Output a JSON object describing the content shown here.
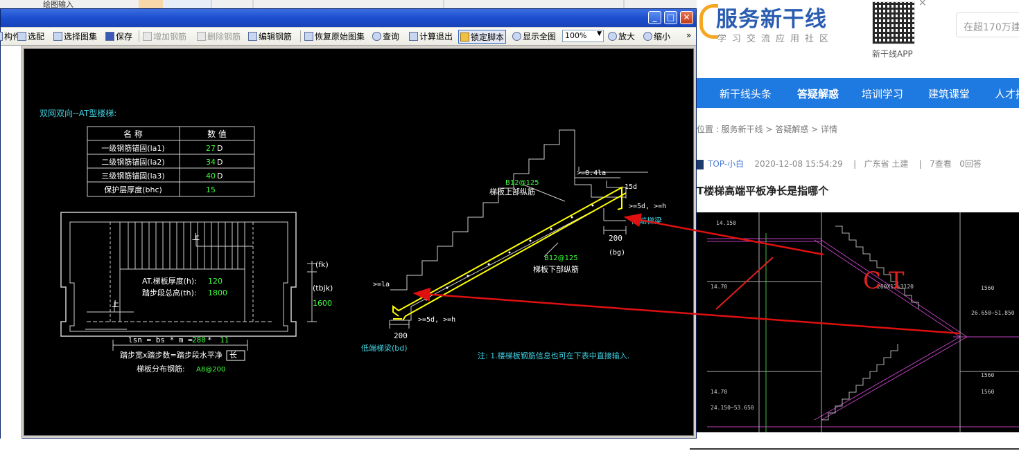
{
  "app": {
    "top_strip_label": "绘图输入",
    "window_buttons": {
      "minimize": "_",
      "maximize": "□",
      "close": "✕"
    },
    "toolbar": {
      "items": [
        {
          "label": "构件",
          "icon": "component-icon"
        },
        {
          "label": "选配",
          "icon": "select-config-icon"
        },
        {
          "label": "选择图集",
          "icon": "atlas-icon"
        },
        {
          "label": "保存",
          "icon": "save-icon"
        },
        {
          "label": "增加钢筋",
          "icon": "add-rebar-icon",
          "disabled": true
        },
        {
          "label": "删除钢筋",
          "icon": "delete-rebar-icon",
          "disabled": true
        },
        {
          "label": "编辑钢筋",
          "icon": "edit-rebar-icon"
        },
        {
          "label": "恢复原始图集",
          "icon": "restore-atlas-icon"
        },
        {
          "label": "查询",
          "icon": "binoculars-icon"
        },
        {
          "label": "计算退出",
          "icon": "calc-exit-icon"
        },
        {
          "label": "锁定脚本",
          "icon": "lock-icon",
          "pressed": true
        },
        {
          "label": "显示全图",
          "icon": "show-all-icon"
        },
        {
          "label": "放大",
          "icon": "zoom-in-icon"
        },
        {
          "label": "缩小",
          "icon": "zoom-out-icon"
        }
      ],
      "zoom_value": "100%",
      "overflow": "»"
    },
    "drawing": {
      "title": "双网双向--AT型楼梯:",
      "table_headers": [
        "名  称",
        "数  值"
      ],
      "table_rows": [
        {
          "name": "一级钢筋锚固(la1)",
          "value": "27",
          "unit": "D"
        },
        {
          "name": "二级钢筋锚固(la2)",
          "value": "34",
          "unit": "D"
        },
        {
          "name": "三级钢筋锚固(la3)",
          "value": "40",
          "unit": "D"
        },
        {
          "name": "保护层厚度(bhc)",
          "value": "15",
          "unit": ""
        }
      ],
      "slab_thickness_label": "AT.梯板厚度(h):",
      "slab_thickness_value": "120",
      "step_height_label": "踏步段总高(th):",
      "step_height_value": "1800",
      "up_label": "上",
      "fk_label": "(fk)",
      "tbjk_label": "(tbjk)",
      "tbjk_value": "1600",
      "lsn_formula_prefix": "lsn = bs * m = ",
      "lsn_bs": "280",
      "lsn_op": " * ",
      "lsn_m": "11",
      "lsn_caption": "踏步宽x踏步数=踏步段水平净",
      "lsn_caption_box": "长",
      "distribution_label": "梯板分布钢筋:",
      "distribution_value": "A8@200",
      "top_rebar_code": "B12@125",
      "top_rebar_label": "梯板上部纵筋",
      "bottom_rebar_code": "B12@125",
      "bottom_rebar_label": "梯板下部纵筋",
      "anchor_top": ">=0.4la",
      "anchor_15d": "15d",
      "anchor_5d_top": ">=5d, >=h",
      "high_beam_label": "高端梯梁",
      "high_beam_width": "200",
      "high_beam_code": "(bg)",
      "anchor_la": ">=la",
      "anchor_5d_bottom": ">=5d, >=h",
      "low_beam_width": "200",
      "low_beam_label": "低端梯梁(bd)",
      "note": "注: 1.楼梯板钢筋信息也可在下表中直接输入."
    }
  },
  "web": {
    "logo_name": "服务新干线",
    "logo_slogan": "学习交流应用社区",
    "qr_label": "新干线APP",
    "qr_close": "×",
    "search_placeholder": "在超170万建",
    "nav": [
      "新干线头条",
      "答疑解惑",
      "培训学习",
      "建筑课堂",
      "人才招"
    ],
    "breadcrumb": "位置 : 服务新干线 > 答疑解惑 > 详情",
    "meta": {
      "user": "TOP-小白",
      "time": "2020-12-08 15:54:29",
      "location": "广东省  土建",
      "views": "7查看",
      "answers": "0回答"
    },
    "question_title": "T楼梯高端平板净长是指哪个",
    "cad_texts": [
      "14.150",
      "14.70",
      "14.70",
      "24.150~53.650",
      "26.650~51.850",
      "260X12=3120",
      "1560",
      "1560",
      "1560",
      "C T"
    ]
  },
  "colors": {
    "title_blue": "#2a5db0",
    "nav_blue": "#1e79e0",
    "cad_cyan": "#3fd0e0",
    "cad_yellow": "#ffff00",
    "cad_green": "#40ff40",
    "arrow_red": "#e01010"
  }
}
